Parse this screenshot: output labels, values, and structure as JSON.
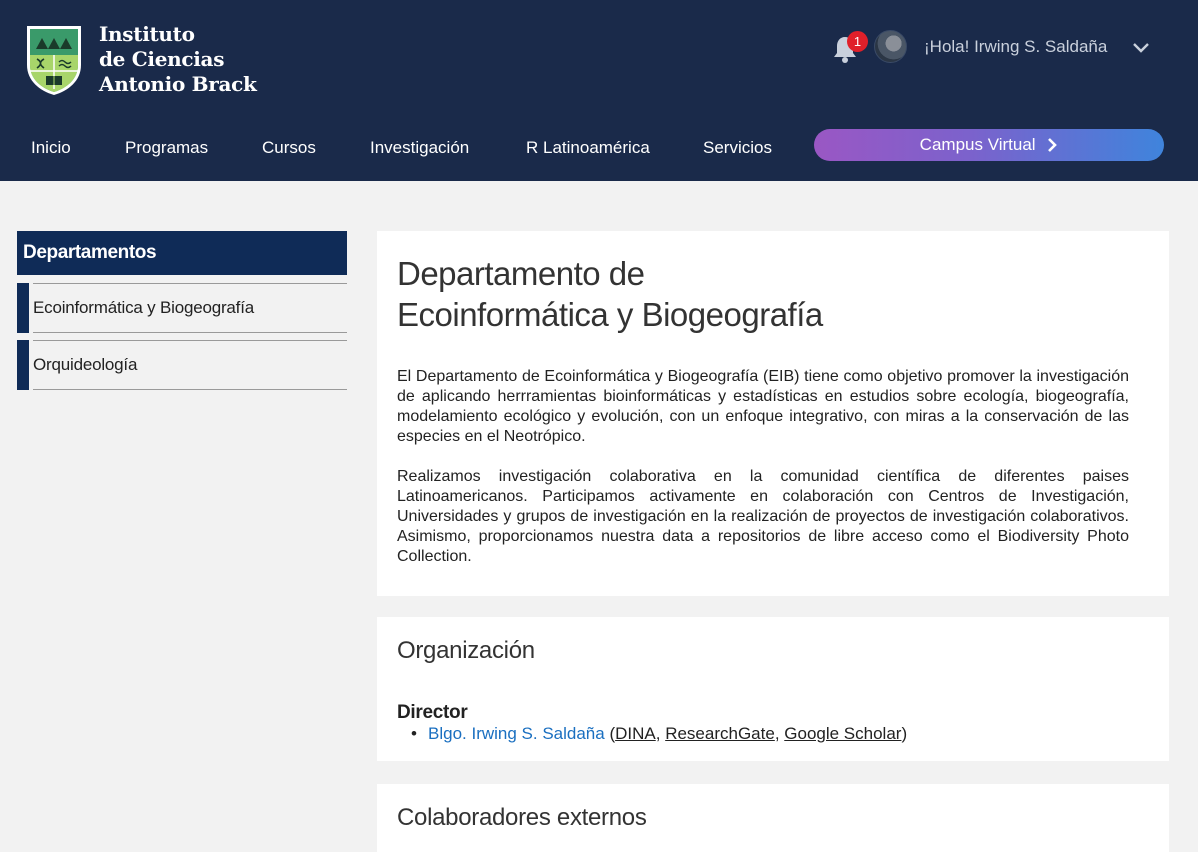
{
  "header": {
    "logo_text": "Instituto\nde Ciencias\nAntonio Brack",
    "notification_count": "1",
    "greeting": "¡Hola! Irwing S. Saldaña"
  },
  "nav": {
    "items": [
      {
        "label": "Inicio"
      },
      {
        "label": "Programas"
      },
      {
        "label": "Cursos"
      },
      {
        "label": "Investigación"
      },
      {
        "label": "R Latinoamérica"
      },
      {
        "label": "Servicios"
      }
    ],
    "campus_label": "Campus Virtual"
  },
  "sidebar": {
    "title": "Departamentos",
    "items": [
      {
        "label": "Ecoinformática y Biogeografía"
      },
      {
        "label": "Orquideología"
      }
    ]
  },
  "main": {
    "title_line1": "Departamento de",
    "title_line2": "Ecoinformática y Biogeografía",
    "paragraph1": "El Departamento de Ecoinformática y Biogeografía (EIB) tiene como objetivo promover la investigación de aplicando herrramientas bioinformáticas y estadísticas en estudios sobre ecología, biogeografía, modelamiento ecológico y evolución, con un enfoque integrativo, con miras a la conservación de las especies en el Neotrópico.",
    "paragraph2": "Realizamos investigación colaborativa en la comunidad científica de diferentes paises Latinoamericanos. Participamos activamente en colaboración con Centros de Investigación, Universidades y grupos de investigación en la realización de proyectos de investigación colaborativos. Asimismo, proporcionamos nuestra data a repositorios de libre acceso como el Biodiversity Photo Collection."
  },
  "organization": {
    "title": "Organización",
    "director_label": "Director",
    "director_name": "Blgo. Irwing S. Saldaña",
    "open_paren": " (",
    "link1": "DINA",
    "sep1": ", ",
    "link2": "ResearchGate",
    "sep2": ", ",
    "link3": "Google Scholar",
    "close_paren": ")"
  },
  "external": {
    "title": "Colaboradores externos"
  },
  "colors": {
    "header_bg": "#1a2a4a",
    "sidebar_accent": "#0f2b57",
    "link": "#1a6fc0",
    "badge": "#e0202a"
  },
  "icons": {
    "logo": "institute-shield-logo",
    "notifications": "bell-icon",
    "menu": "chevron-down-icon",
    "campus": "chevron-right-icon"
  }
}
